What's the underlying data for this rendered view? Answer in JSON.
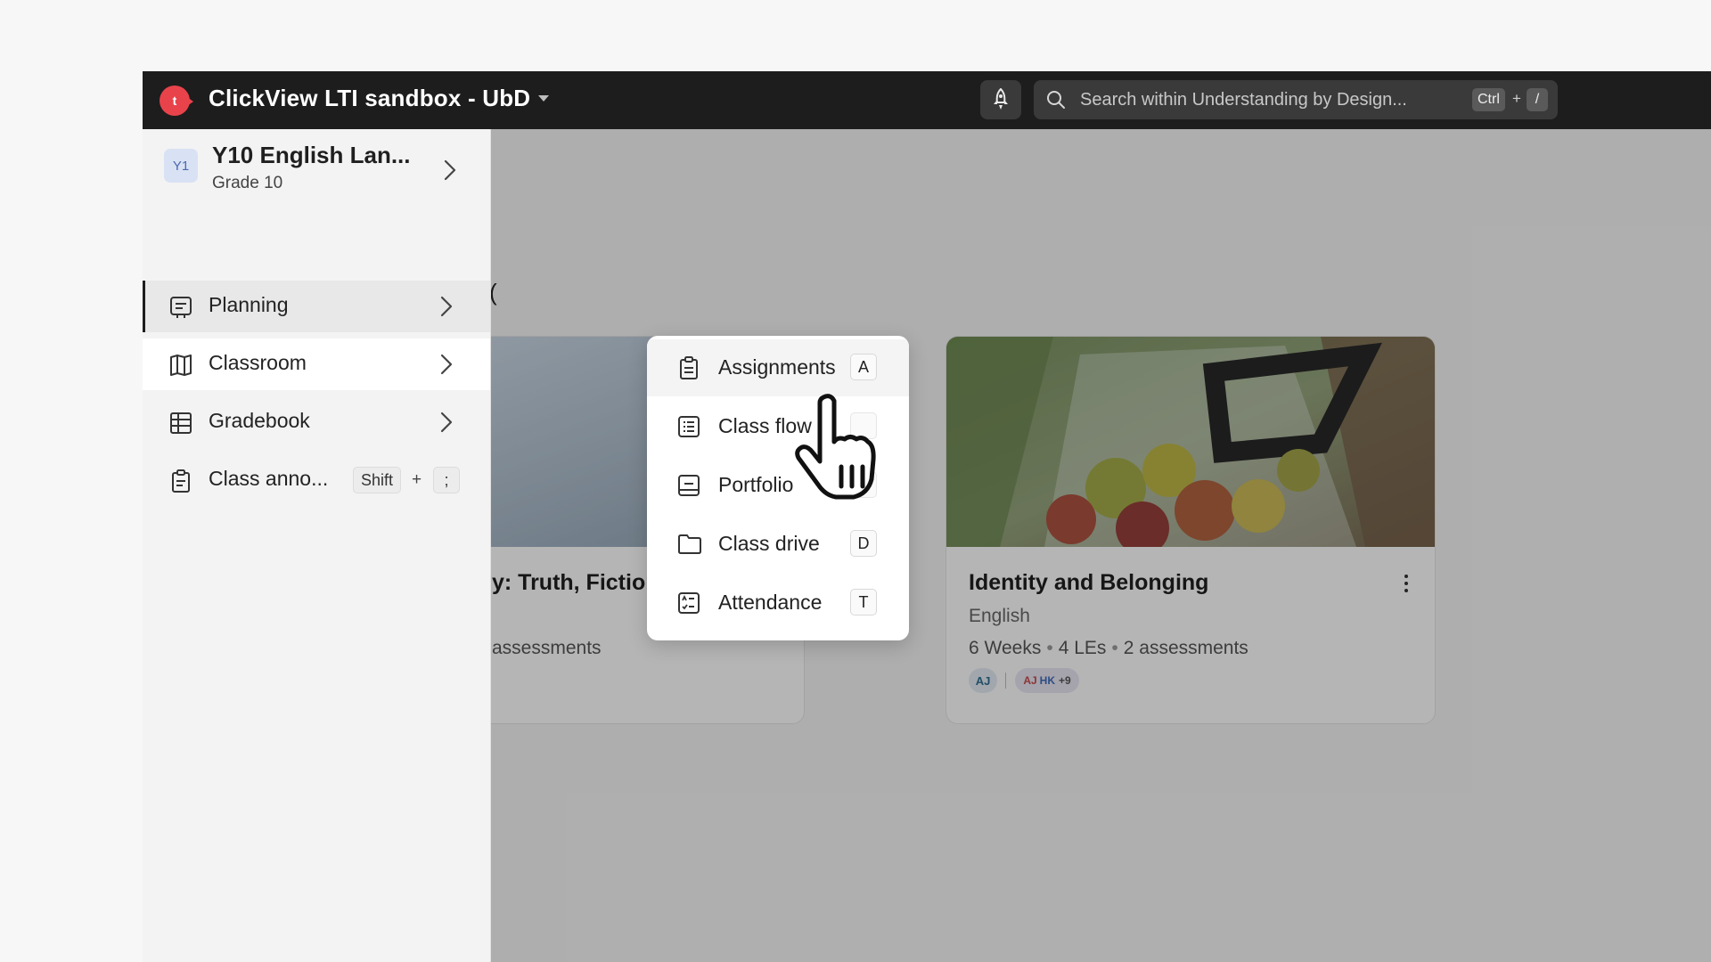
{
  "app": {
    "logo_letter": "t",
    "title": "ClickView LTI sandbox - UbD"
  },
  "search": {
    "placeholder": "Search within Understanding by Design...",
    "shortcut_key1": "Ctrl",
    "shortcut_plus": "+",
    "shortcut_key2": "/"
  },
  "class_info": {
    "badge": "Y1",
    "name": "Y10 English Lan...",
    "grade": "Grade 10"
  },
  "nav": {
    "planning": "Planning",
    "classroom": "Classroom",
    "gradebook": "Gradebook",
    "announcements": "Class anno...",
    "announcements_key1": "Shift",
    "announcements_plus": "+",
    "announcements_key2": ";"
  },
  "menu": {
    "items": [
      {
        "label": "Assignments",
        "key": "A"
      },
      {
        "label": "Class flow",
        "key": ""
      },
      {
        "label": "Portfolio",
        "key": ""
      },
      {
        "label": "Class drive",
        "key": "D"
      },
      {
        "label": "Attendance",
        "key": "T"
      }
    ]
  },
  "cards": {
    "partial_paren": "(",
    "left": {
      "title": "y: Truth, Fiction, a...",
      "meta": "assessments"
    },
    "right": {
      "title": "Identity and Belonging",
      "subject": "English",
      "duration": "6 Weeks",
      "les": "4 LEs",
      "assessments": "2 assessments",
      "sep": "•",
      "avatar_1": "AJ",
      "avatar_group_a": "AJ",
      "avatar_group_b": "HK",
      "avatar_more": "+9"
    }
  },
  "colors": {
    "topbar": "#1d1d1d",
    "brand": "#e8434b",
    "overlay": "rgba(0,0,0,0.28)"
  }
}
